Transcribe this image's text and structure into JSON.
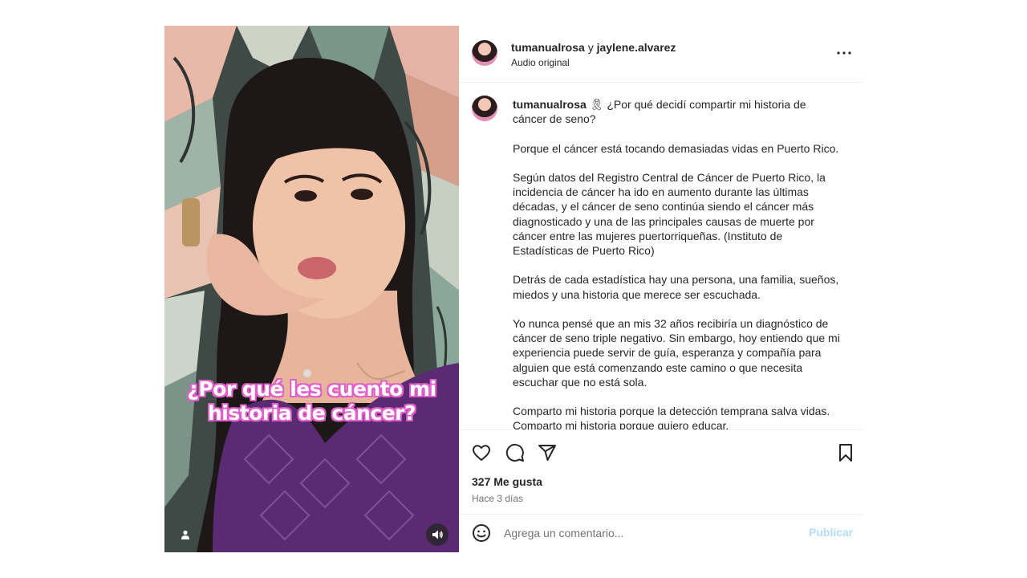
{
  "media": {
    "overlay_line1": "¿Por qué les cuento mi",
    "overlay_line2": "historia de cáncer?",
    "overlay_outline_color": "#e05fc9"
  },
  "header": {
    "author": "tumanualrosa",
    "connector": "y",
    "collaborator": "jaylene.alvarez",
    "audio": "Audio original"
  },
  "caption": {
    "username": "tumanualrosa",
    "emoji": "🎗",
    "text": " ¿Por qué decidí compartir mi historia de cáncer de seno?\n\nPorque el cáncer está tocando demasiadas vidas en Puerto Rico.\n\nSegún datos del Registro Central de Cáncer de Puerto Rico, la incidencia de cáncer ha ido en aumento durante las últimas décadas, y el cáncer de seno continúa siendo el cáncer más diagnosticado y una de las principales causas de muerte por cáncer entre las mujeres puertorriqueñas. (Instituto de Estadísticas de Puerto Rico)\n\nDetrás de cada estadística hay una persona, una familia, sueños, miedos y una historia que merece ser escuchada.\n\nYo nunca pensé que an mis 32 años recibiría un diagnóstico de cáncer de seno triple negativo. Sin embargo, hoy entiendo que mi experiencia puede servir de guía, esperanza y compañía para alguien que está comenzando este camino o que necesita escuchar que no está sola.\n\nComparto mi historia porque la detección temprana salva vidas. Comparto mi historia porque quiero educar."
  },
  "actions": {
    "likes": "327 Me gusta",
    "time": "Hace 3 días"
  },
  "comment": {
    "placeholder": "Agrega un comentario...",
    "post_label": "Publicar",
    "post_color": "#b3dbff"
  }
}
